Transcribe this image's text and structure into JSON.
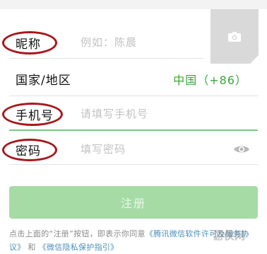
{
  "nickname": {
    "label": "昵称",
    "placeholder": "例如：陈晨"
  },
  "region": {
    "label": "国家/地区",
    "value": "中国（+86）"
  },
  "phone": {
    "label": "手机号",
    "placeholder": "请填写手机号"
  },
  "password": {
    "label": "密码",
    "placeholder": "填写密码"
  },
  "register_button": "注册",
  "terms": {
    "prefix": "点击上面的“注册”按钮，即表示你同意",
    "link1": "《腾讯微信软件许可及服务协议》",
    "and": " 和 ",
    "link2": "《微信隐私保护指引》"
  },
  "watermark": "游侠网",
  "colors": {
    "accent_green": "#3aa53a",
    "button_disabled": "#a6dba6",
    "annotation_red": "#a8171c",
    "link_blue": "#4a8fb8"
  },
  "icons": [
    "camera-icon",
    "eye-icon"
  ]
}
